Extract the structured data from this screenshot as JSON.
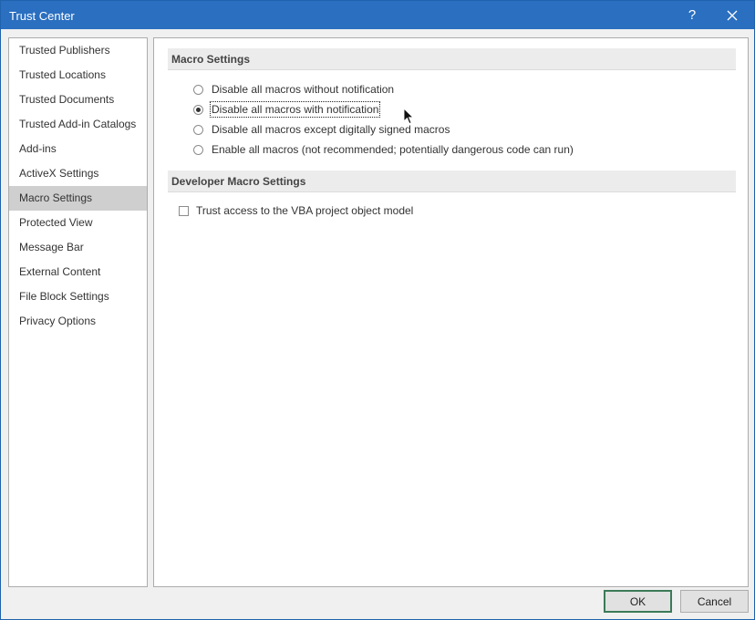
{
  "window": {
    "title": "Trust Center",
    "help_label": "?"
  },
  "sidebar": {
    "items": [
      {
        "label": "Trusted Publishers"
      },
      {
        "label": "Trusted Locations"
      },
      {
        "label": "Trusted Documents"
      },
      {
        "label": "Trusted Add-in Catalogs"
      },
      {
        "label": "Add-ins"
      },
      {
        "label": "ActiveX Settings"
      },
      {
        "label": "Macro Settings",
        "selected": true
      },
      {
        "label": "Protected View"
      },
      {
        "label": "Message Bar"
      },
      {
        "label": "External Content"
      },
      {
        "label": "File Block Settings"
      },
      {
        "label": "Privacy Options"
      }
    ]
  },
  "macro_settings": {
    "header": "Macro Settings",
    "options": [
      {
        "label": "Disable all macros without notification",
        "checked": false
      },
      {
        "label": "Disable all macros with notification",
        "checked": true
      },
      {
        "label": "Disable all macros except digitally signed macros",
        "checked": false
      },
      {
        "label": "Enable all macros (not recommended; potentially dangerous code can run)",
        "checked": false
      }
    ]
  },
  "developer_settings": {
    "header": "Developer Macro Settings",
    "vba_checkbox_label": "Trust access to the VBA project object model",
    "vba_checked": false
  },
  "buttons": {
    "ok": "OK",
    "cancel": "Cancel"
  },
  "icons": {
    "close": "close-icon",
    "help": "help-icon",
    "cursor": "mouse-pointer-icon"
  },
  "colors": {
    "titlebar": "#2a6fc0",
    "selected_item": "#cfcfcf",
    "default_button_border": "#3c7a58"
  }
}
